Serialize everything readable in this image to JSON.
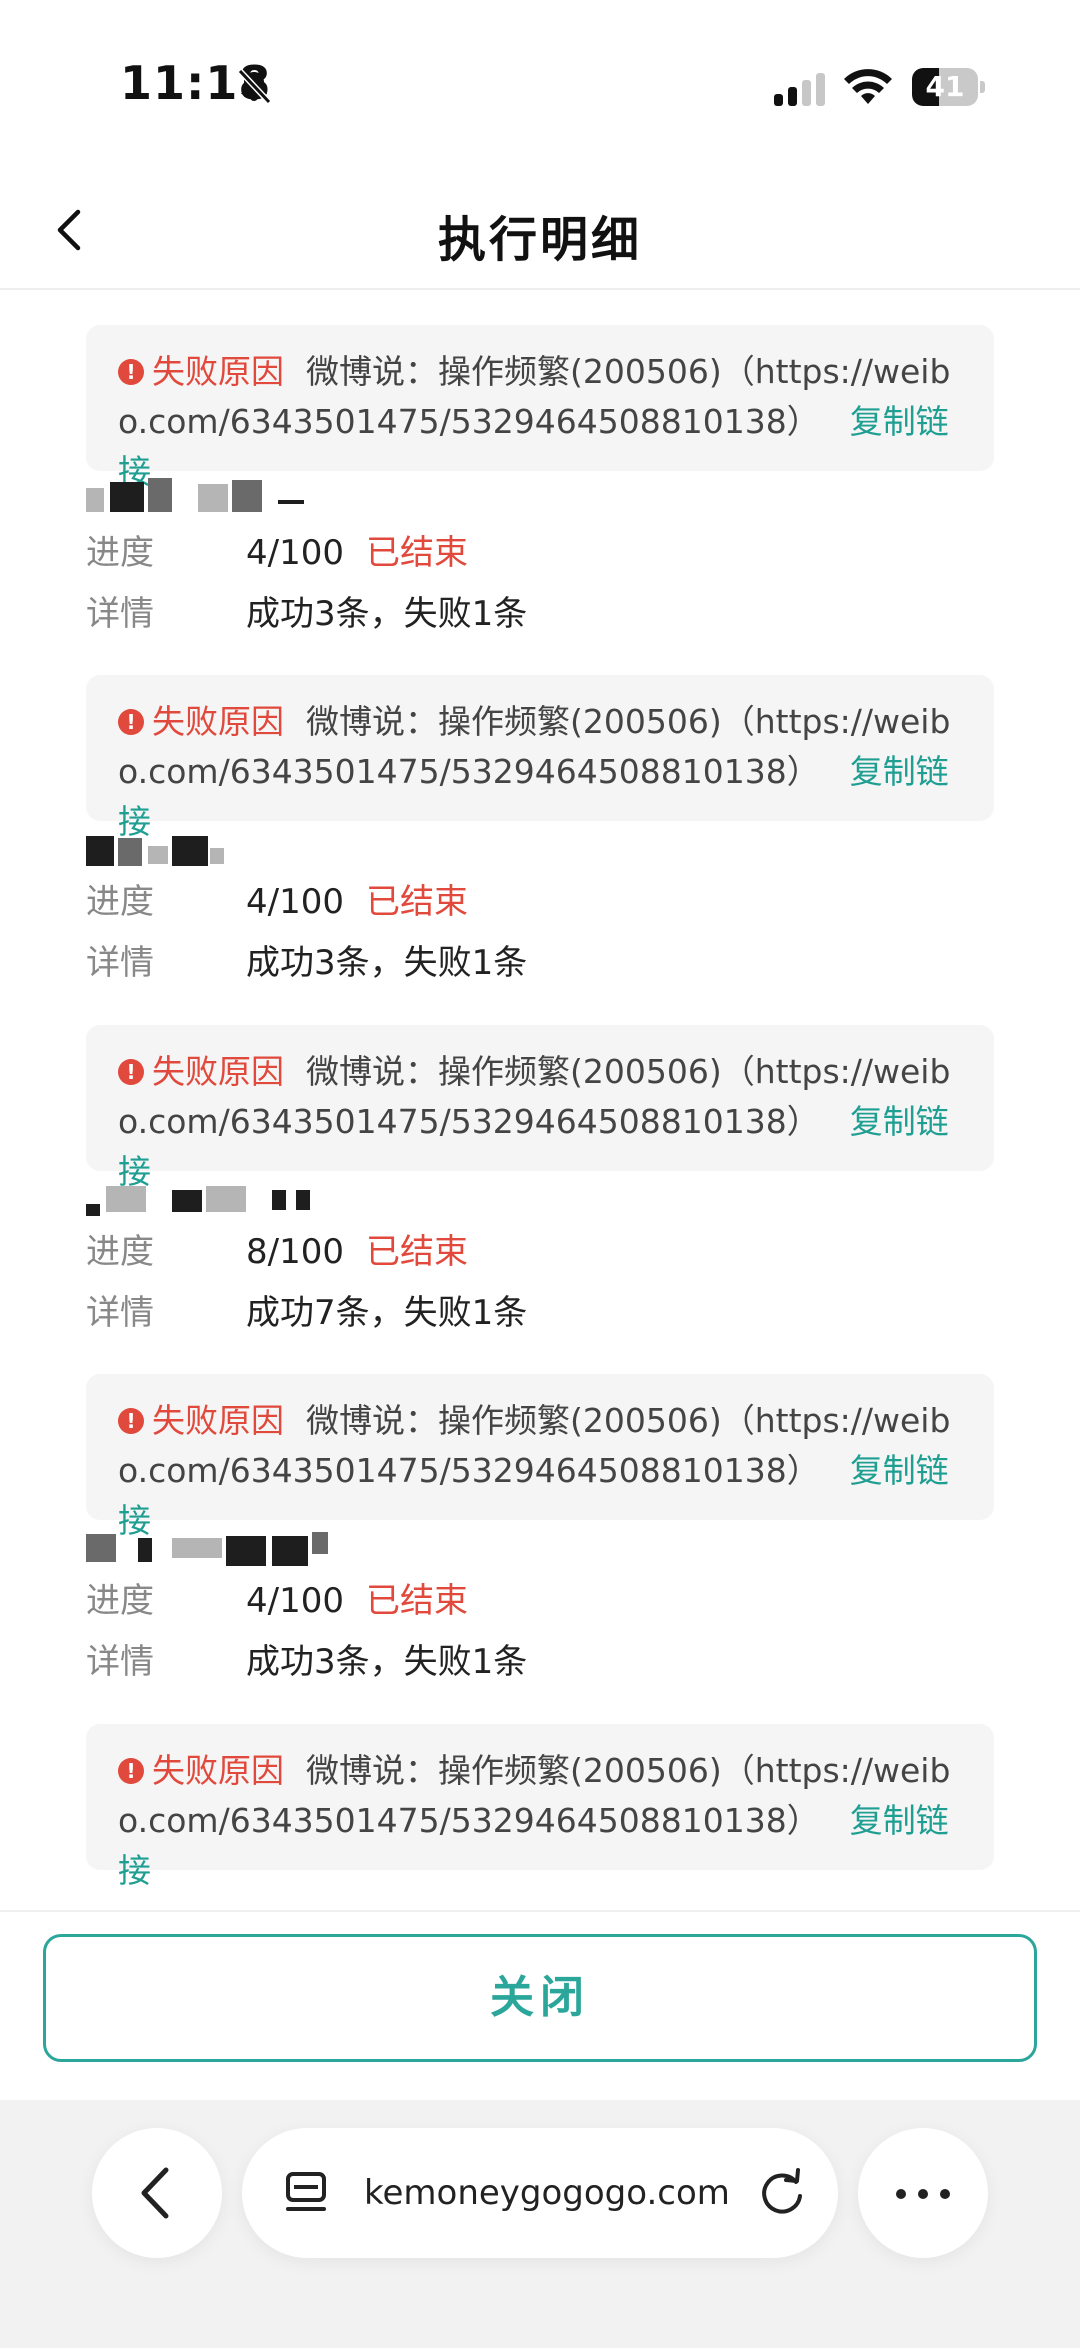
{
  "status_bar": {
    "time": "11:18",
    "battery_level": "41",
    "battery_fraction": 0.41
  },
  "nav": {
    "title": "执行明细"
  },
  "labels": {
    "fail_reason": "失败原因",
    "progress": "进度",
    "detail": "详情",
    "copy_link": "复制链接",
    "ended": "已结束"
  },
  "failure_message": "微博说：操作频繁(200506)（https://weibo.com/6343501475/5329464508810138）",
  "tasks": [
    {
      "progress": "4/100",
      "status": "已结束",
      "detail": "成功3条，失败1条",
      "failure": "微博说：操作频繁(200506)（https://weibo.com/6343501475/5329464508810138）"
    },
    {
      "progress": "4/100",
      "status": "已结束",
      "detail": "成功3条，失败1条",
      "failure": "微博说：操作频繁(200506)（https://weibo.com/6343501475/5329464508810138）"
    },
    {
      "progress": "8/100",
      "status": "已结束",
      "detail": "成功7条，失败1条",
      "failure": "微博说：操作频繁(200506)（https://weibo.com/6343501475/5329464508810138）"
    },
    {
      "progress": "4/100",
      "status": "已结束",
      "detail": "成功3条，失败1条",
      "failure": "微博说：操作频繁(200506)（https://weibo.com/6343501475/5329464508810138）"
    }
  ],
  "close_button": "关闭",
  "browser": {
    "url": "kemoneygogogo.com"
  },
  "colors": {
    "accent": "#2ba69a",
    "error": "#e0493b"
  }
}
